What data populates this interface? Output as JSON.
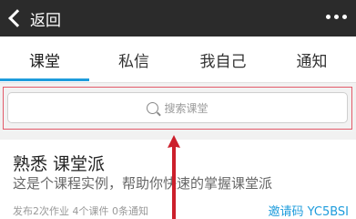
{
  "topbar": {
    "back_label": "返回"
  },
  "tabs": [
    {
      "label": "课堂",
      "active": true
    },
    {
      "label": "私信",
      "active": false
    },
    {
      "label": "我自己",
      "active": false
    },
    {
      "label": "通知",
      "active": false
    }
  ],
  "search": {
    "text": "搜索课堂"
  },
  "card": {
    "title": "熟悉 课堂派",
    "desc": "这是个课程实例，帮助你快速的掌握课堂派",
    "meta": "发布2次作业 4个课件 0条通知",
    "invite": "邀请码 YC5BSI"
  },
  "colors": {
    "accent": "#1e9cdc",
    "highlight": "#e25b6a",
    "arrow": "#cc1f2b"
  }
}
